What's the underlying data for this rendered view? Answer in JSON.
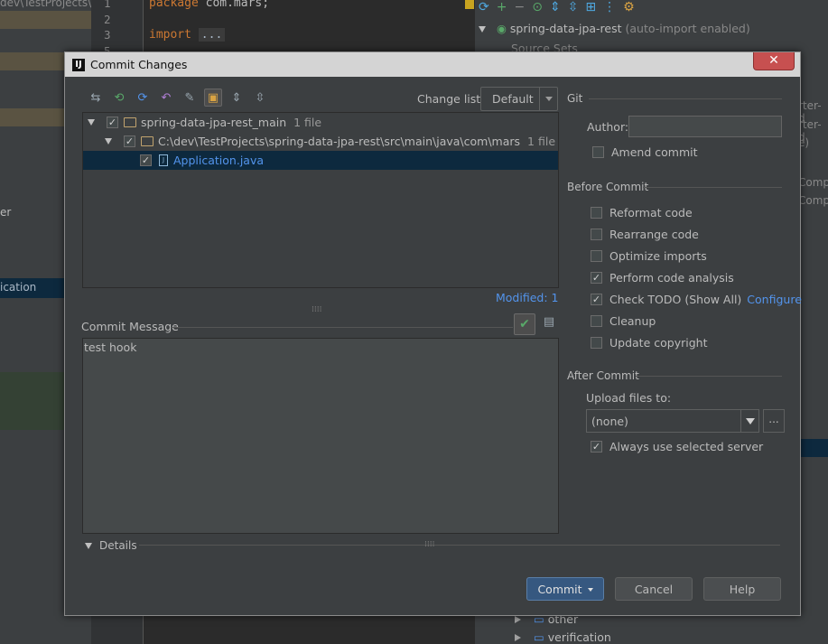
{
  "background": {
    "path_fragment": "dev\\TestProjects\\s",
    "project_label_fragment": "er",
    "selected_label_fragment": "ication",
    "line_numbers": [
      "1",
      "2",
      "3",
      "5"
    ],
    "code": {
      "line1_kw": "package",
      "line1_rest": " com.mars;",
      "line3_kw": "import",
      "line3_fold": "..."
    },
    "project_tree": {
      "root_name": "spring-data-jpa-rest",
      "root_suffix": "(auto-import enabled)",
      "source_sets": "Source Sets",
      "peek_lines": [
        "rter-d",
        "rter-d",
        "e)",
        "Comp",
        "Comp"
      ],
      "node_other": "other",
      "node_verification": "verification"
    }
  },
  "dialog": {
    "title": "Commit Changes",
    "close_symbol": "✕",
    "app_icon_text": "IJ",
    "toolbar_icons": [
      "diff-icon",
      "refresh-changes-icon",
      "move-changelist-icon",
      "revert-icon",
      "edit-source-icon",
      "group-by-directory-icon",
      "expand-all-icon",
      "collapse-all-icon"
    ],
    "changelist": {
      "label": "Change list:",
      "value": "Default"
    },
    "tree": {
      "root": {
        "label": "spring-data-jpa-rest_main",
        "count": "1 file"
      },
      "folder": {
        "label": "C:\\dev\\TestProjects\\spring-data-jpa-rest\\src\\main\\java\\com\\mars",
        "count": "1 file"
      },
      "file": {
        "label": "Application.java"
      }
    },
    "modified": "Modified: 1",
    "commit_message": {
      "label": "Commit Message",
      "value": "test hook"
    },
    "details_label": "Details",
    "git": {
      "section": "Git",
      "author_label": "Author:",
      "author_value": "",
      "amend_label": "Amend commit",
      "amend_checked": false
    },
    "before_commit": {
      "section": "Before Commit",
      "options": [
        {
          "label": "Reformat code",
          "checked": false
        },
        {
          "label": "Rearrange code",
          "checked": false
        },
        {
          "label": "Optimize imports",
          "checked": false
        },
        {
          "label": "Perform code analysis",
          "checked": true
        },
        {
          "label": "Check TODO (Show All)",
          "checked": true,
          "link": "Configure"
        },
        {
          "label": "Cleanup",
          "checked": false
        },
        {
          "label": "Update copyright",
          "checked": false
        }
      ]
    },
    "after_commit": {
      "section": "After Commit",
      "upload_label": "Upload files to:",
      "upload_value": "(none)",
      "browse_label": "...",
      "always_label": "Always use selected server",
      "always_checked": true
    },
    "buttons": {
      "commit": "Commit",
      "cancel": "Cancel",
      "help": "Help"
    },
    "colors": {
      "link": "#5394ec",
      "selection": "#0d293e",
      "primary_button": "#365880",
      "keyword": "#cc7832"
    }
  }
}
